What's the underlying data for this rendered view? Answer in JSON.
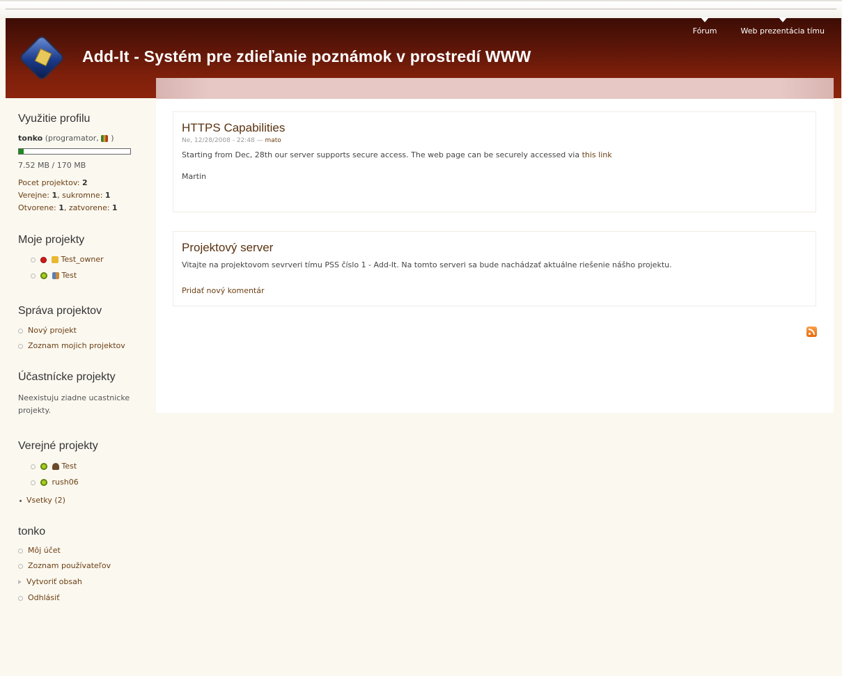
{
  "site": {
    "title": "Add-It - Systém pre zdieľanie poznámok v prostredí WWW",
    "topnav": [
      "Fórum",
      "Web prezentácia tímu"
    ]
  },
  "profile": {
    "heading": "Využitie profilu",
    "username": "tonko",
    "role": "(programator, ",
    "role_close": ")",
    "usage_text": "7.52 MB / 170 MB",
    "usage_fraction": 0.044,
    "projects_count_label": "Pocet projektov: ",
    "projects_count": "2",
    "public_label": "Verejne: ",
    "public_count": "1",
    "private_label": ", sukromne: ",
    "private_count": "1",
    "open_label": "Otvorene: ",
    "open_count": "1",
    "closed_label": ", zatvorene: ",
    "closed_count": "1"
  },
  "my_projects": {
    "heading": "Moje projekty",
    "items": [
      {
        "name": "Test_owner",
        "status": "red",
        "icon": "lock-icon"
      },
      {
        "name": "Test",
        "status": "green",
        "icon": "group-icon"
      }
    ]
  },
  "manage": {
    "heading": "Správa projektov",
    "items": [
      "Nový projekt",
      "Zoznam mojich projektov"
    ]
  },
  "participant": {
    "heading": "Účastnícke projekty",
    "line1": "Neexistuju ziadne ucastnicke",
    "line2": "projekty."
  },
  "public_projects": {
    "heading": "Verejné projekty",
    "items": [
      {
        "name": "Test",
        "status": "green",
        "icon": "user-icon"
      },
      {
        "name": "rush06",
        "status": "green",
        "icon": ""
      }
    ],
    "all_link": "Vsetky (2)"
  },
  "user_menu": {
    "heading": "tonko",
    "items": [
      "Môj účet",
      "Zoznam používateľov",
      "Vytvoriť obsah",
      "Odhlásiť"
    ]
  },
  "posts": [
    {
      "title": "HTTPS Capabilities",
      "date": "Ne, 12/28/2008 - 22:48 — ",
      "author": "mato",
      "body": "Starting from Dec, 28th our server supports secure access. The web page can be securely accessed via ",
      "body_link": "this link",
      "signature": "Martin"
    },
    {
      "title": "Projektový server",
      "body": "Vitajte na projektovom sevrveri tímu PSS číslo 1 - Add-It. Na tomto serveri sa bude nachádzať aktuálne riešenie nášho projektu.",
      "comment_link": "Pridať nový komentár"
    }
  ],
  "colors": {
    "header": "#7c1f0b",
    "link": "#6b3f12",
    "background": "#fbf8f0"
  }
}
